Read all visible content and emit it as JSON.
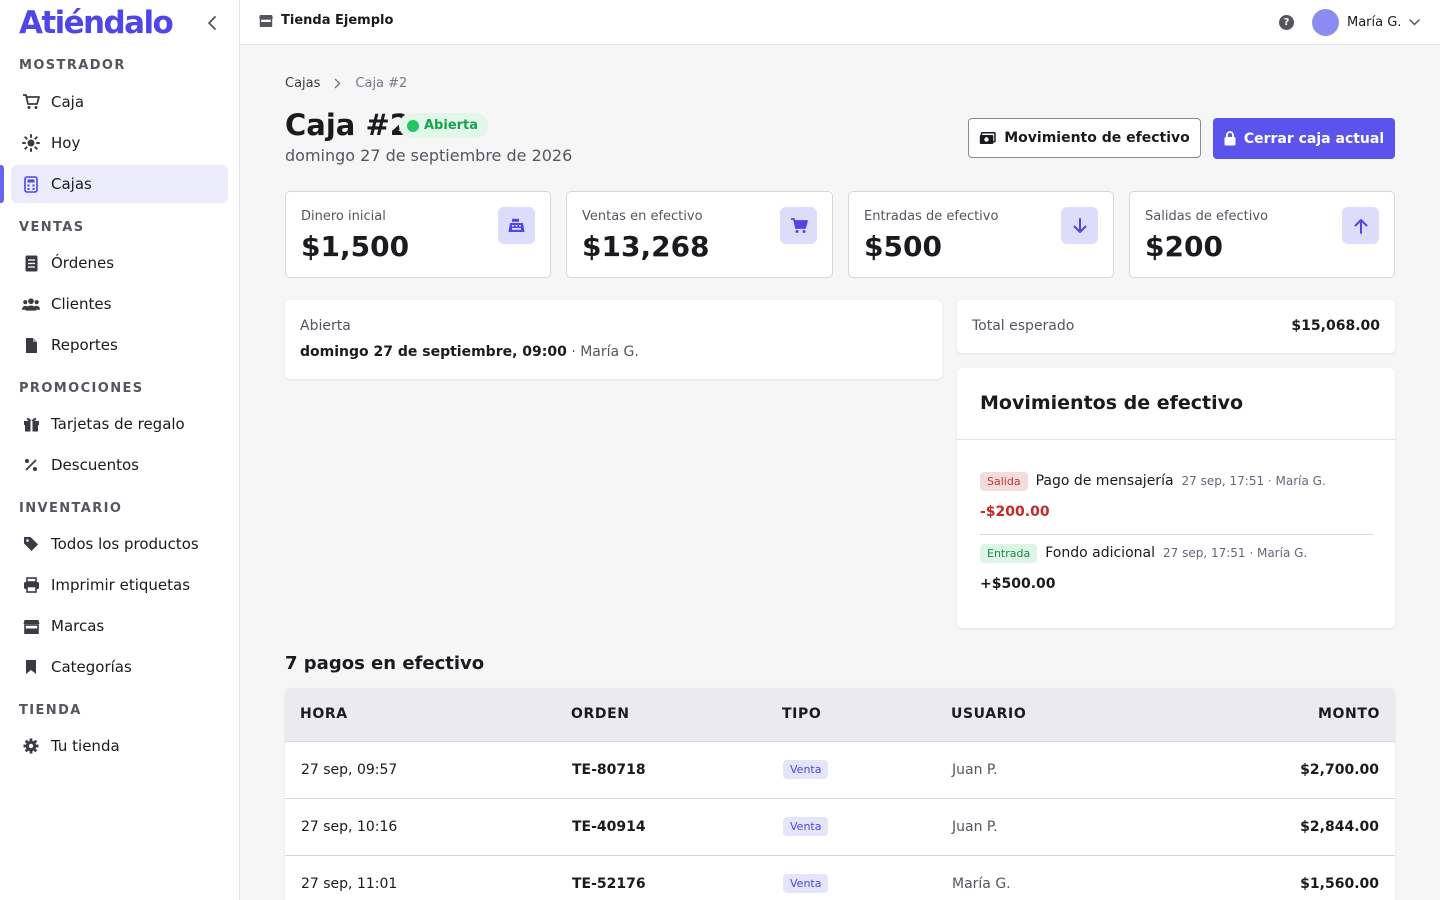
{
  "app": {
    "name": "Atiéndalo"
  },
  "sidebar": {
    "sections": [
      {
        "title": "MOSTRADOR",
        "items": [
          {
            "label": "Caja",
            "icon": "cart-icon"
          },
          {
            "label": "Hoy",
            "icon": "sun-icon"
          },
          {
            "label": "Cajas",
            "icon": "calculator-icon",
            "active": true
          }
        ]
      },
      {
        "title": "VENTAS",
        "items": [
          {
            "label": "Órdenes",
            "icon": "receipt-icon"
          },
          {
            "label": "Clientes",
            "icon": "users-icon"
          },
          {
            "label": "Reportes",
            "icon": "document-icon"
          }
        ]
      },
      {
        "title": "PROMOCIONES",
        "items": [
          {
            "label": "Tarjetas de regalo",
            "icon": "gift-icon"
          },
          {
            "label": "Descuentos",
            "icon": "percent-icon"
          }
        ]
      },
      {
        "title": "INVENTARIO",
        "items": [
          {
            "label": "Todos los productos",
            "icon": "tag-icon"
          },
          {
            "label": "Imprimir etiquetas",
            "icon": "printer-icon"
          },
          {
            "label": "Marcas",
            "icon": "store-icon"
          },
          {
            "label": "Categorías",
            "icon": "bookmark-icon"
          }
        ]
      },
      {
        "title": "TIENDA",
        "items": [
          {
            "label": "Tu tienda",
            "icon": "gear-icon"
          }
        ]
      }
    ]
  },
  "topbar": {
    "store_name": "Tienda Ejemplo",
    "help": "?",
    "user_name": "María G."
  },
  "breadcrumb": {
    "parent": "Cajas",
    "current": "Caja #2"
  },
  "page": {
    "title": "Caja #2",
    "status": "Abierta",
    "date": "domingo 27 de septiembre de 2026",
    "btn_move": "Movimiento de efectivo",
    "btn_close": "Cerrar caja actual"
  },
  "stats": [
    {
      "label": "Dinero inicial",
      "value": "$1,500",
      "icon": "cash-register-icon"
    },
    {
      "label": "Ventas en efectivo",
      "value": "$13,268",
      "icon": "cart-icon"
    },
    {
      "label": "Entradas de efectivo",
      "value": "$500",
      "icon": "arrow-down-icon"
    },
    {
      "label": "Salidas de efectivo",
      "value": "$200",
      "icon": "arrow-up-icon"
    }
  ],
  "opened": {
    "label": "Abierta",
    "datetime": "domingo 27 de septiembre, 09:00",
    "separator": "·",
    "user": "María G."
  },
  "expected": {
    "label": "Total esperado",
    "value": "$15,068.00"
  },
  "moves": {
    "title": "Movimientos de efectivo",
    "items": [
      {
        "tag": "Salida",
        "desc": "Pago de mensajería",
        "meta": "27 sep, 17:51 · María G.",
        "amount": "-$200.00",
        "kind": "out"
      },
      {
        "tag": "Entrada",
        "desc": "Fondo adicional",
        "meta": "27 sep, 17:51 · María G.",
        "amount": "+$500.00",
        "kind": "in"
      }
    ]
  },
  "payments": {
    "title": "7 pagos en efectivo",
    "columns": [
      "HORA",
      "ORDEN",
      "TIPO",
      "USUARIO",
      "MONTO"
    ],
    "rows": [
      {
        "time": "27 sep, 09:57",
        "order": "TE-80718",
        "type": "Venta",
        "user": "Juan P.",
        "amount": "$2,700.00"
      },
      {
        "time": "27 sep, 10:16",
        "order": "TE-40914",
        "type": "Venta",
        "user": "Juan P.",
        "amount": "$2,844.00"
      },
      {
        "time": "27 sep, 11:01",
        "order": "TE-52176",
        "type": "Venta",
        "user": "María G.",
        "amount": "$1,560.00"
      }
    ]
  }
}
